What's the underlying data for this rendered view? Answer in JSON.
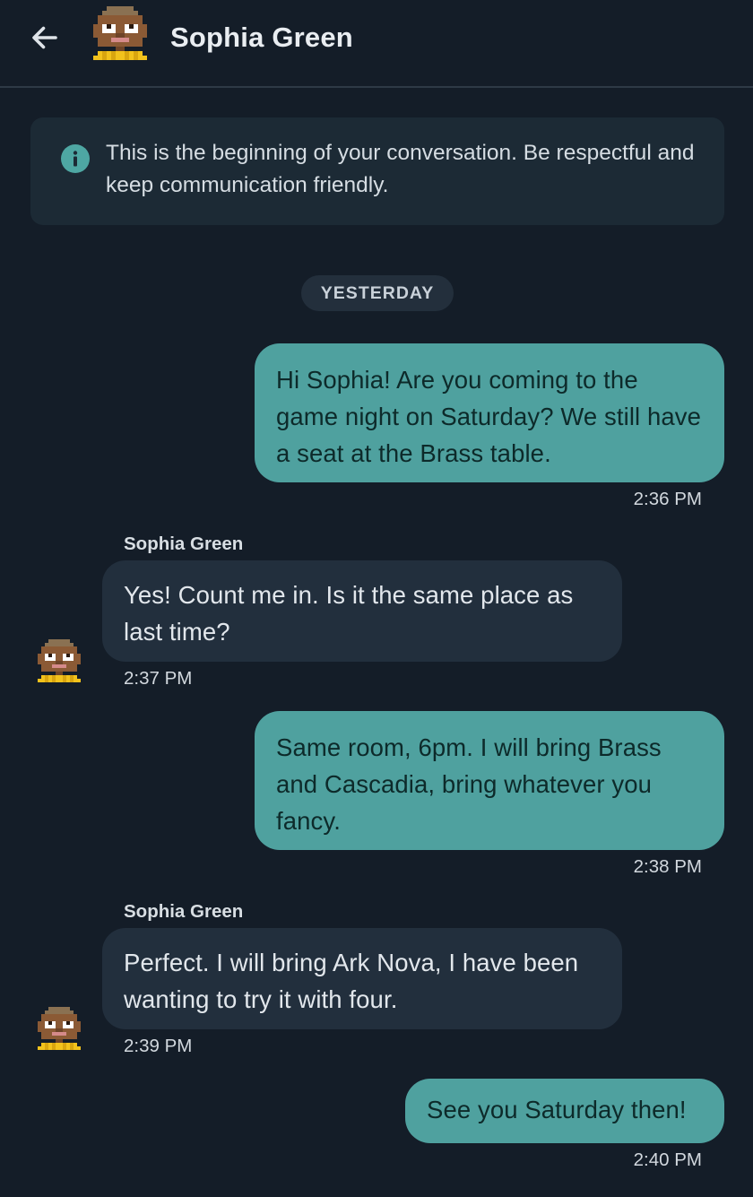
{
  "header": {
    "back_icon": "arrow-left-icon",
    "avatar_icon": "pixel-avatar-icon",
    "title": "Sophia Green"
  },
  "banner": {
    "icon": "info-icon",
    "text": "This is the beginning of your conversation. Be respectful and keep communication friendly."
  },
  "date_separator": "YESTERDAY",
  "messages": [
    {
      "direction": "outgoing",
      "text": "Hi Sophia! Are you coming to the game night on Saturday? We still have a seat at the Brass table.",
      "time": "2:36 PM"
    },
    {
      "direction": "incoming",
      "sender": "Sophia Green",
      "text": "Yes! Count me in. Is it the same place as last time?",
      "time": "2:37 PM"
    },
    {
      "direction": "outgoing",
      "text": "Same room, 6pm. I will bring Brass and Cascadia, bring whatever you fancy.",
      "time": "2:38 PM"
    },
    {
      "direction": "incoming",
      "sender": "Sophia Green",
      "text": "Perfect. I will bring Ark Nova, I have been wanting to try it with four.",
      "time": "2:39 PM"
    },
    {
      "direction": "outgoing",
      "text": "See you Saturday then!",
      "time": "2:40 PM"
    }
  ],
  "colors": {
    "background": "#141d28",
    "outgoing_bubble": "#4fa19f",
    "incoming_bubble": "#222f3d",
    "banner_bg": "#1c2a35",
    "info_icon": "#4ea7a3"
  }
}
